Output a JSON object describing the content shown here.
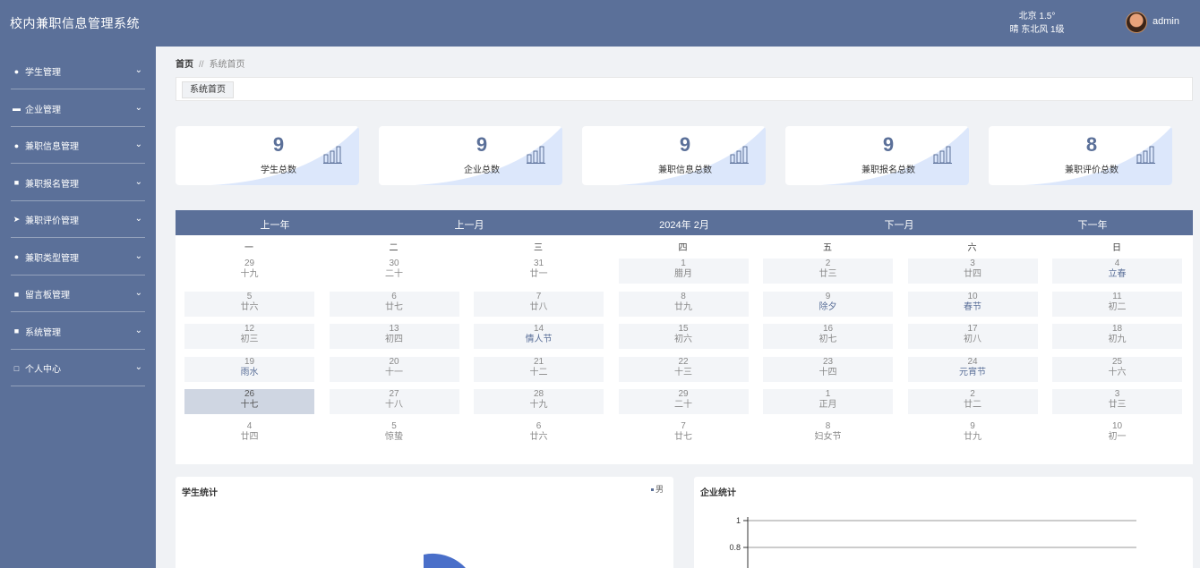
{
  "header": {
    "app_title": "校内兼职信息管理系统",
    "weather_line1": "北京  1.5°",
    "weather_line2": "晴  东北风  1级",
    "user": "admin"
  },
  "sidebar": {
    "items": [
      {
        "label": "学生管理",
        "icon": "lightbulb-icon"
      },
      {
        "label": "企业管理",
        "icon": "chat-icon"
      },
      {
        "label": "兼职信息管理",
        "icon": "user-icon"
      },
      {
        "label": "兼职报名管理",
        "icon": "grid-icon"
      },
      {
        "label": "兼职评价管理",
        "icon": "send-icon"
      },
      {
        "label": "兼职类型管理",
        "icon": "user-icon"
      },
      {
        "label": "留言板管理",
        "icon": "grid-icon"
      },
      {
        "label": "系统管理",
        "icon": "grid-icon"
      },
      {
        "label": "个人中心",
        "icon": "window-icon"
      }
    ]
  },
  "breadcrumb": {
    "home": "首页",
    "separator": "//",
    "current": "系统首页"
  },
  "tabs": [
    {
      "label": "系统首页"
    }
  ],
  "stats": [
    {
      "value": "9",
      "label": "学生总数"
    },
    {
      "value": "9",
      "label": "企业总数"
    },
    {
      "value": "9",
      "label": "兼职信息总数"
    },
    {
      "value": "9",
      "label": "兼职报名总数"
    },
    {
      "value": "8",
      "label": "兼职评价总数"
    }
  ],
  "calendar": {
    "prev_year": "上一年",
    "prev_month": "上一月",
    "title": "2024年 2月",
    "next_month": "下一月",
    "next_year": "下一年",
    "weekdays": [
      "一",
      "二",
      "三",
      "四",
      "五",
      "六",
      "日"
    ],
    "weeks": [
      [
        {
          "d": "29",
          "l": "十九"
        },
        {
          "d": "30",
          "l": "二十"
        },
        {
          "d": "31",
          "l": "廿一"
        },
        {
          "d": "1",
          "l": "腊月"
        },
        {
          "d": "2",
          "l": "廿三"
        },
        {
          "d": "3",
          "l": "廿四"
        },
        {
          "d": "4",
          "l": "立春",
          "f": true
        }
      ],
      [
        {
          "d": "5",
          "l": "廿六"
        },
        {
          "d": "6",
          "l": "廿七"
        },
        {
          "d": "7",
          "l": "廿八"
        },
        {
          "d": "8",
          "l": "廿九"
        },
        {
          "d": "9",
          "l": "除夕",
          "f": true
        },
        {
          "d": "10",
          "l": "春节",
          "f": true
        },
        {
          "d": "11",
          "l": "初二"
        }
      ],
      [
        {
          "d": "12",
          "l": "初三"
        },
        {
          "d": "13",
          "l": "初四"
        },
        {
          "d": "14",
          "l": "情人节",
          "f": true
        },
        {
          "d": "15",
          "l": "初六"
        },
        {
          "d": "16",
          "l": "初七"
        },
        {
          "d": "17",
          "l": "初八"
        },
        {
          "d": "18",
          "l": "初九"
        }
      ],
      [
        {
          "d": "19",
          "l": "雨水",
          "f": true
        },
        {
          "d": "20",
          "l": "十一"
        },
        {
          "d": "21",
          "l": "十二"
        },
        {
          "d": "22",
          "l": "十三"
        },
        {
          "d": "23",
          "l": "十四"
        },
        {
          "d": "24",
          "l": "元宵节",
          "f": true
        },
        {
          "d": "25",
          "l": "十六"
        }
      ],
      [
        {
          "d": "26",
          "l": "十七",
          "today": true
        },
        {
          "d": "27",
          "l": "十八"
        },
        {
          "d": "28",
          "l": "十九"
        },
        {
          "d": "29",
          "l": "二十"
        },
        {
          "d": "1",
          "l": "正月"
        },
        {
          "d": "2",
          "l": "廿二"
        },
        {
          "d": "3",
          "l": "廿三"
        }
      ],
      [
        {
          "d": "4",
          "l": "廿四"
        },
        {
          "d": "5",
          "l": "惊蛰"
        },
        {
          "d": "6",
          "l": "廿六"
        },
        {
          "d": "7",
          "l": "廿七"
        },
        {
          "d": "8",
          "l": "妇女节"
        },
        {
          "d": "9",
          "l": "廿九"
        },
        {
          "d": "10",
          "l": "初一"
        }
      ]
    ]
  },
  "panels": {
    "student_title": "学生统计",
    "student_legend": "男",
    "company_title": "企业统计",
    "company_ticks": [
      "1",
      "0.8"
    ]
  },
  "colors": {
    "primary": "#5b7099",
    "accent_blue": "#4a6fc9"
  }
}
